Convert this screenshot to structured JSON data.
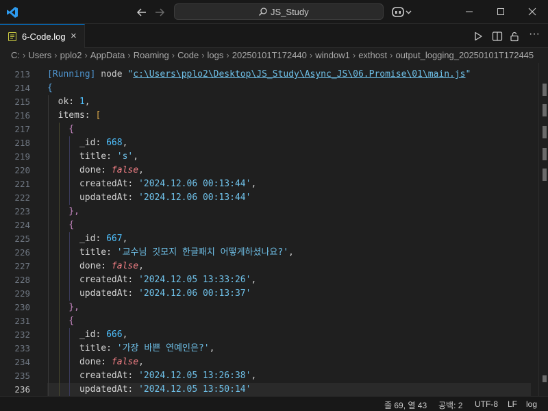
{
  "titlebar": {
    "search_text": "JS_Study"
  },
  "tab": {
    "label": "6-Code.log",
    "close_glyph": "×"
  },
  "breadcrumb": [
    "C:",
    "Users",
    "pplo2",
    "AppData",
    "Roaming",
    "Code",
    "logs",
    "20250101T172440",
    "window1",
    "exthost",
    "output_logging_20250101T172445"
  ],
  "editor": {
    "line_numbers": [
      "213",
      "214",
      "215",
      "216",
      "217",
      "218",
      "219",
      "220",
      "221",
      "222",
      "223",
      "224",
      "225",
      "226",
      "227",
      "228",
      "229",
      "230",
      "231",
      "232",
      "233",
      "234",
      "235",
      "236"
    ],
    "lines": [
      [
        {
          "t": "[Running]",
          "c": "k-run"
        },
        {
          "t": " node ",
          "c": "k-plain"
        },
        {
          "t": "\"",
          "c": "k-path-q"
        },
        {
          "t": "c:\\Users\\pplo2\\Desktop\\JS_Study\\Async_JS\\06.Promise\\01\\main.js",
          "c": "k-path"
        },
        {
          "t": "\"",
          "c": "k-path-q"
        }
      ],
      [
        {
          "t": "{",
          "c": "k-brace"
        }
      ],
      [
        {
          "t": "  ok: ",
          "c": "k-prop"
        },
        {
          "t": "1",
          "c": "k-num"
        },
        {
          "t": ",",
          "c": "k-plain"
        }
      ],
      [
        {
          "t": "  items: ",
          "c": "k-prop"
        },
        {
          "t": "[",
          "c": "k-bracket"
        }
      ],
      [
        {
          "t": "    {",
          "c": "k-brace2"
        }
      ],
      [
        {
          "t": "      _id: ",
          "c": "k-prop"
        },
        {
          "t": "668",
          "c": "k-num"
        },
        {
          "t": ",",
          "c": "k-plain"
        }
      ],
      [
        {
          "t": "      title: ",
          "c": "k-prop"
        },
        {
          "t": "'s'",
          "c": "k-str"
        },
        {
          "t": ",",
          "c": "k-plain"
        }
      ],
      [
        {
          "t": "      done: ",
          "c": "k-prop"
        },
        {
          "t": "false",
          "c": "k-bool"
        },
        {
          "t": ",",
          "c": "k-plain"
        }
      ],
      [
        {
          "t": "      createdAt: ",
          "c": "k-prop"
        },
        {
          "t": "'2024.12.06 00:13:44'",
          "c": "k-str"
        },
        {
          "t": ",",
          "c": "k-plain"
        }
      ],
      [
        {
          "t": "      updatedAt: ",
          "c": "k-prop"
        },
        {
          "t": "'2024.12.06 00:13:44'",
          "c": "k-str"
        }
      ],
      [
        {
          "t": "    },",
          "c": "k-brace2"
        }
      ],
      [
        {
          "t": "    {",
          "c": "k-brace2"
        }
      ],
      [
        {
          "t": "      _id: ",
          "c": "k-prop"
        },
        {
          "t": "667",
          "c": "k-num"
        },
        {
          "t": ",",
          "c": "k-plain"
        }
      ],
      [
        {
          "t": "      title: ",
          "c": "k-prop"
        },
        {
          "t": "'교수님 깃모지 한글패치 어떻게하셨나요?'",
          "c": "k-str"
        },
        {
          "t": ",",
          "c": "k-plain"
        }
      ],
      [
        {
          "t": "      done: ",
          "c": "k-prop"
        },
        {
          "t": "false",
          "c": "k-bool"
        },
        {
          "t": ",",
          "c": "k-plain"
        }
      ],
      [
        {
          "t": "      createdAt: ",
          "c": "k-prop"
        },
        {
          "t": "'2024.12.05 13:33:26'",
          "c": "k-str"
        },
        {
          "t": ",",
          "c": "k-plain"
        }
      ],
      [
        {
          "t": "      updatedAt: ",
          "c": "k-prop"
        },
        {
          "t": "'2024.12.06 00:13:37'",
          "c": "k-str"
        }
      ],
      [
        {
          "t": "    },",
          "c": "k-brace2"
        }
      ],
      [
        {
          "t": "    {",
          "c": "k-brace2"
        }
      ],
      [
        {
          "t": "      _id: ",
          "c": "k-prop"
        },
        {
          "t": "666",
          "c": "k-num"
        },
        {
          "t": ",",
          "c": "k-plain"
        }
      ],
      [
        {
          "t": "      title: ",
          "c": "k-prop"
        },
        {
          "t": "'가장 바쁜 연예인은?'",
          "c": "k-str"
        },
        {
          "t": ",",
          "c": "k-plain"
        }
      ],
      [
        {
          "t": "      done: ",
          "c": "k-prop"
        },
        {
          "t": "false",
          "c": "k-bool"
        },
        {
          "t": ",",
          "c": "k-plain"
        }
      ],
      [
        {
          "t": "      createdAt: ",
          "c": "k-prop"
        },
        {
          "t": "'2024.12.05 13:26:38'",
          "c": "k-str"
        },
        {
          "t": ",",
          "c": "k-plain"
        }
      ],
      [
        {
          "t": "      updatedAt: ",
          "c": "k-prop"
        },
        {
          "t": "'2024.12.05 13:50:14'",
          "c": "k-str"
        }
      ]
    ],
    "current_line": "236"
  },
  "statusbar": {
    "position": "줄 69, 열 43",
    "indent": "공백: 2",
    "encoding": "UTF-8",
    "eol": "LF",
    "language": "log"
  },
  "colors": {
    "accent": "#0078d4",
    "editor_bg": "#1f1f1f",
    "chrome_bg": "#181818"
  },
  "icons": [
    "vscode-logo-icon",
    "arrow-left-icon",
    "arrow-right-icon",
    "search-icon",
    "copilot-icon",
    "minimize-icon",
    "maximize-icon",
    "close-icon",
    "log-file-icon",
    "run-icon",
    "split-editor-icon",
    "lock-icon",
    "more-icon"
  ]
}
